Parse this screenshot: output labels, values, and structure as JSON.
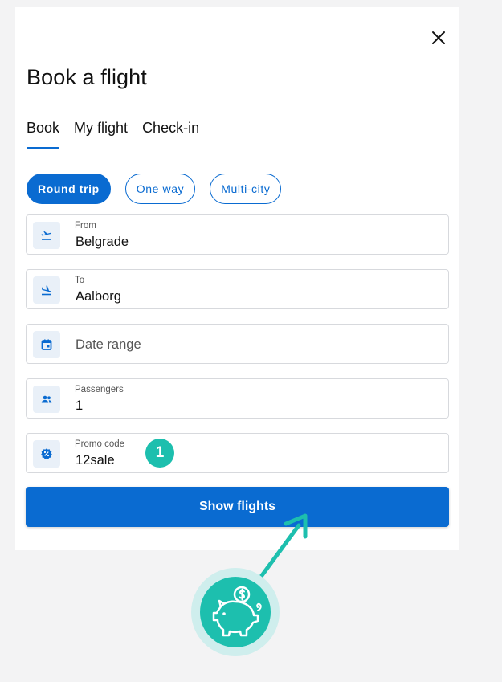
{
  "dialog": {
    "title": "Book a flight",
    "close_icon": "close-icon"
  },
  "tabs": [
    {
      "label": "Book",
      "active": true
    },
    {
      "label": "My flight",
      "active": false
    },
    {
      "label": "Check-in",
      "active": false
    }
  ],
  "trip_types": [
    {
      "label": "Round trip",
      "selected": true
    },
    {
      "label": "One way",
      "selected": false
    },
    {
      "label": "Multi-city",
      "selected": false
    }
  ],
  "fields": {
    "from": {
      "label": "From",
      "value": "Belgrade",
      "icon": "takeoff-icon"
    },
    "to": {
      "label": "To",
      "value": "Aalborg",
      "icon": "landing-icon"
    },
    "dates": {
      "placeholder": "Date range",
      "icon": "calendar-icon"
    },
    "passengers": {
      "label": "Passengers",
      "value": "1",
      "icon": "people-icon"
    },
    "promo": {
      "label": "Promo code",
      "value": "12sale",
      "icon": "discount-icon"
    }
  },
  "annotation": {
    "badge_number": "1",
    "accent_color": "#1dbfae"
  },
  "cta": {
    "label": "Show flights"
  },
  "colors": {
    "primary": "#0a6bd1",
    "accent": "#1dbfae",
    "background": "#f3f3f4"
  }
}
